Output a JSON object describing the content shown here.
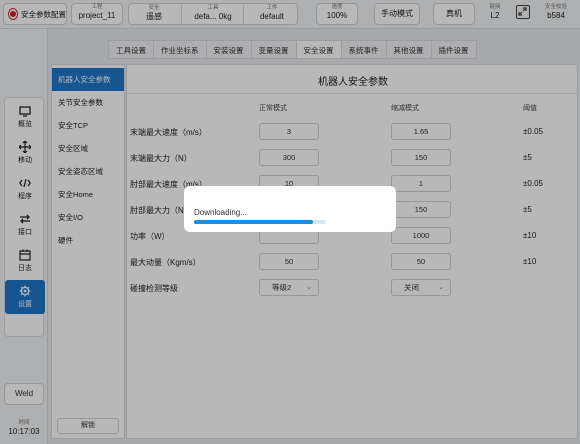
{
  "topbar": {
    "safety_config": "安全参数配置",
    "project_label": "工程",
    "project_value": "project_11",
    "safety_label": "安全",
    "safety_value": "遥感",
    "tool_label": "工具",
    "tool_value": "defa... 0kg",
    "workpiece_label": "工件",
    "workpiece_value": "default",
    "speed_label": "速度",
    "speed_value": "100%",
    "mode": "手动模式",
    "machine": "真机",
    "link_label": "链接",
    "link_value": "L2",
    "safety_verify_label": "安全校验",
    "safety_verify_value": "b584"
  },
  "leftnav": {
    "items": [
      {
        "label": "概览",
        "icon": "monitor-icon"
      },
      {
        "label": "移动",
        "icon": "move-icon"
      },
      {
        "label": "程序",
        "icon": "code-icon"
      },
      {
        "label": "接口",
        "icon": "interface-icon"
      },
      {
        "label": "日志",
        "icon": "calendar-icon"
      },
      {
        "label": "设置",
        "icon": "gear-icon"
      }
    ],
    "weld": "Weld",
    "time_label": "时间",
    "time_value": "10:17:03"
  },
  "subtabs": [
    "工具设置",
    "作业坐标系",
    "安装设置",
    "变量设置",
    "安全设置",
    "系统事件",
    "其他设置",
    "插件设置"
  ],
  "sidebar2": {
    "items": [
      "机器人安全参数",
      "关节安全参数",
      "安全TCP",
      "安全区域",
      "安全姿态区域",
      "安全Home",
      "安全I/O",
      "硬件"
    ],
    "unlock": "解锁"
  },
  "main": {
    "title": "机器人安全参数",
    "col_normal": "正常模式",
    "col_reduced": "缩减模式",
    "col_tolerance": "阈值",
    "rows": [
      {
        "label": "末端最大速度（m/s）",
        "normal": "3",
        "reduced": "1.65",
        "tol": "±0.05"
      },
      {
        "label": "末端最大力（N）",
        "normal": "300",
        "reduced": "150",
        "tol": "±5"
      },
      {
        "label": "肘部最大速度（m/s）",
        "normal": "10",
        "reduced": "1",
        "tol": "±0.05"
      },
      {
        "label": "肘部最大力（N）",
        "normal": "",
        "reduced": "150",
        "tol": "±5"
      },
      {
        "label": "功率（W）",
        "normal": "",
        "reduced": "1000",
        "tol": "±10"
      },
      {
        "label": "最大动量（Kgm/s）",
        "normal": "50",
        "reduced": "50",
        "tol": "±10"
      }
    ],
    "collision_label": "碰撞检测等级",
    "collision_normal": "等级2",
    "collision_reduced": "关闭"
  },
  "dialog": {
    "text": "Downloading...",
    "progress": 0.9
  }
}
